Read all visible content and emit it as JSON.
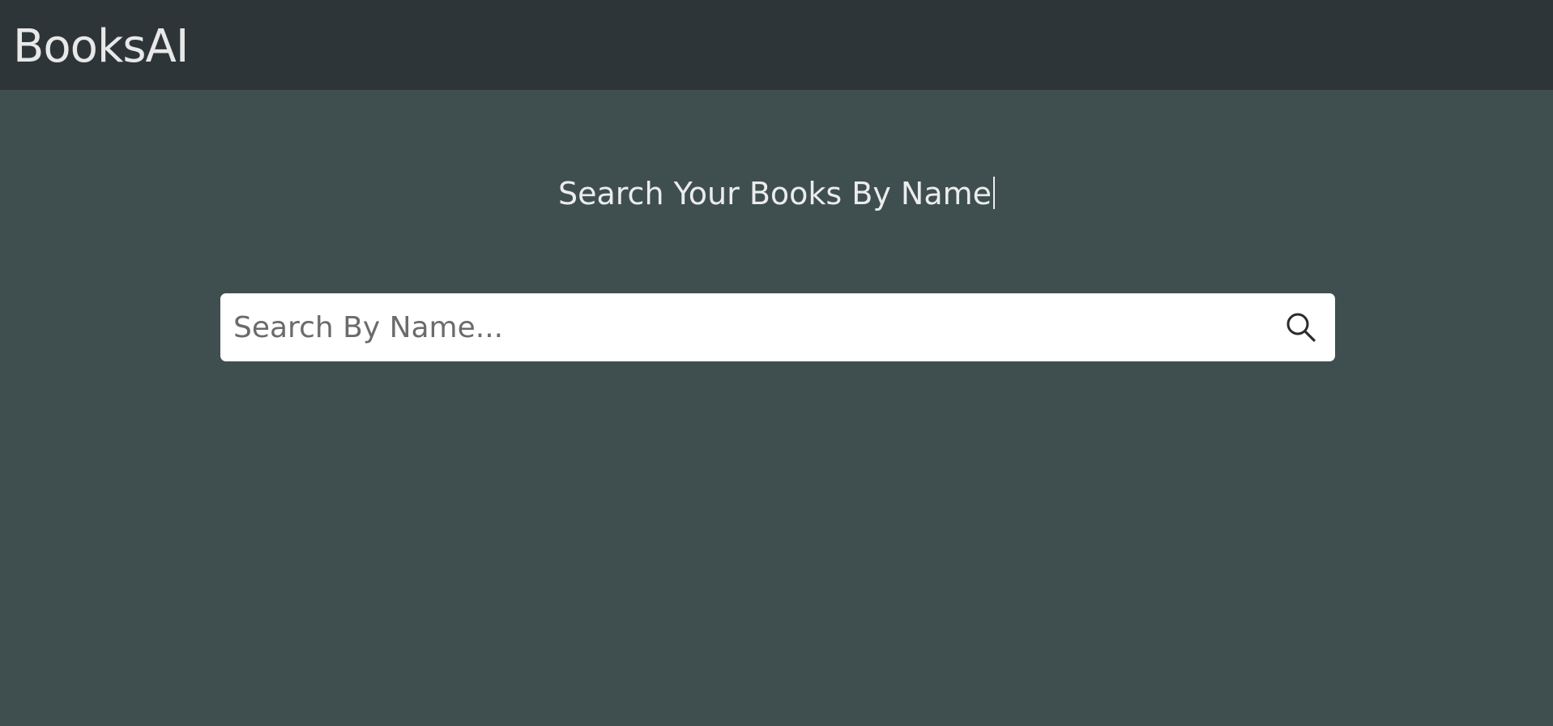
{
  "navbar": {
    "brand": "BooksAI"
  },
  "hero": {
    "title": "Search Your Books By Name"
  },
  "search": {
    "placeholder": "Search By Name...",
    "value": "",
    "icon": "search-icon"
  },
  "colors": {
    "navbar_bg": "#2e3539",
    "page_bg": "#3f4f50",
    "text": "#e8e8e8",
    "input_bg": "#ffffff"
  }
}
